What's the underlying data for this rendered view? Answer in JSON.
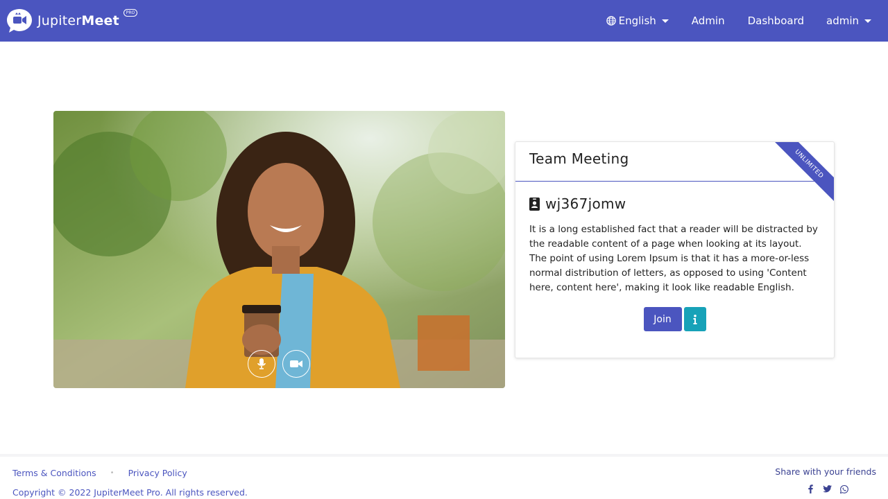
{
  "brand": {
    "name_light": "Jupiter",
    "name_bold": "Meet",
    "badge": "PRO"
  },
  "nav": {
    "language": "English",
    "admin": "Admin",
    "dashboard": "Dashboard",
    "user": "admin"
  },
  "meeting": {
    "title": "Team Meeting",
    "ribbon": "UNLIMITED",
    "id": "wj367jomw",
    "description": "It is a long established fact that a reader will be distracted by the readable content of a page when looking at its layout. The point of using Lorem Ipsum is that it has a more-or-less normal distribution of letters, as opposed to using 'Content here, content here', making it look like readable English.",
    "join_label": "Join"
  },
  "footer": {
    "terms": "Terms & Conditions",
    "separator": "•",
    "privacy": "Privacy Policy",
    "copyright": "Copyright © 2022 JupiterMeet Pro. All rights reserved.",
    "share": "Share with your friends",
    "social": [
      "facebook-icon",
      "twitter-icon",
      "whatsapp-icon"
    ]
  },
  "colors": {
    "primary": "#4b55bf",
    "info": "#17a2b8"
  }
}
